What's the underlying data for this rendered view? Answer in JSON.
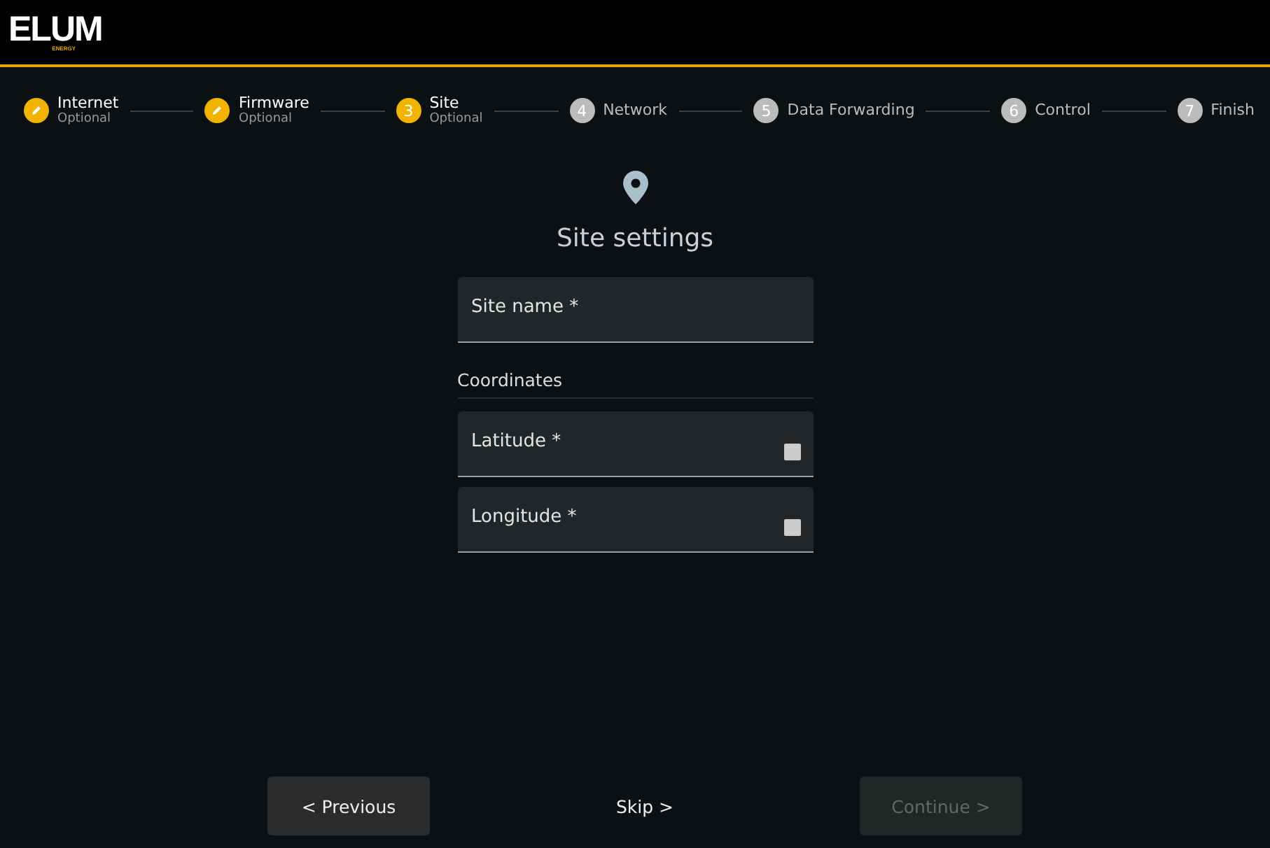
{
  "header": {
    "logo": "ELUM",
    "tagline": "ENERGY"
  },
  "steps": [
    {
      "label": "Internet",
      "sublabel": "Optional",
      "completed": true,
      "selected": false
    },
    {
      "label": "Firmware",
      "sublabel": "Optional",
      "completed": true,
      "selected": false
    },
    {
      "number": "3",
      "label": "Site",
      "sublabel": "Optional",
      "completed": false,
      "selected": true
    },
    {
      "number": "4",
      "label": "Network",
      "completed": false,
      "selected": false
    },
    {
      "number": "5",
      "label": "Data Forwarding",
      "completed": false,
      "selected": false
    },
    {
      "number": "6",
      "label": "Control",
      "completed": false,
      "selected": false
    },
    {
      "number": "7",
      "label": "Finish",
      "completed": false,
      "selected": false
    }
  ],
  "form": {
    "title": "Site settings",
    "fields": [
      {
        "placeholder": "Site name *",
        "kind": "text"
      },
      {
        "kind": "heading",
        "label": "Coordinates"
      },
      {
        "placeholder": "Latitude *",
        "kind": "number"
      },
      {
        "placeholder": "Longitude *",
        "kind": "number"
      }
    ]
  },
  "actions": [
    {
      "label": "< Previous",
      "kind": "filled",
      "disabled": false
    },
    {
      "label": "Skip >",
      "kind": "text",
      "disabled": false
    },
    {
      "label": "Continue >",
      "kind": "filled",
      "disabled": true
    }
  ]
}
